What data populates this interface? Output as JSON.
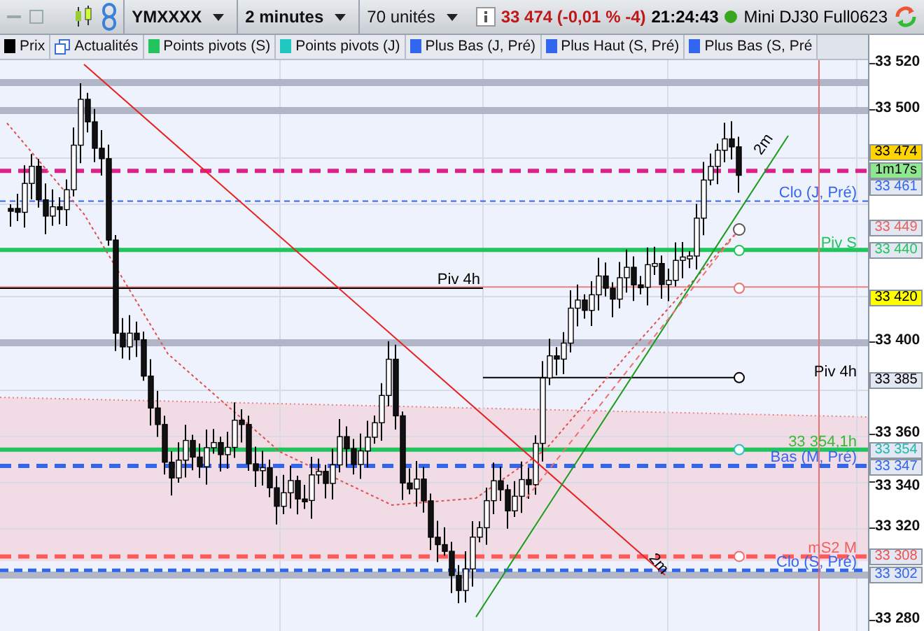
{
  "toolbar": {
    "symbol": "YMXXXX",
    "timeframe": "2 minutes",
    "units": "70 unités",
    "quote": "33 474 (-0,01 % -4)",
    "time": "21:24:43",
    "connected": true,
    "instrument": "Mini DJ30 Full0623"
  },
  "legend": [
    {
      "kind": "swatch",
      "label": "Prix",
      "color": "#000000"
    },
    {
      "kind": "icon",
      "label": "Actualités"
    },
    {
      "kind": "swatch",
      "label": "Points pivots (S)",
      "color": "#22c45e"
    },
    {
      "kind": "swatch",
      "label": "Points pivots (J)",
      "color": "#1fc7c0"
    },
    {
      "kind": "swatch",
      "label": "Plus Bas (J, Pré)",
      "color": "#3366ee"
    },
    {
      "kind": "swatch",
      "label": "Plus Haut (S, Pré)",
      "color": "#3366ee"
    },
    {
      "kind": "swatch",
      "label": "Plus Bas (S, Pré",
      "color": "#3366ee"
    }
  ],
  "annotations": [
    {
      "text": "Piv 4h",
      "color": "#000000"
    },
    {
      "text": "Clo (J, Pré)",
      "color": "#3366ee"
    },
    {
      "text": "Piv S",
      "color": "#22c45e"
    },
    {
      "text": "Piv 4h",
      "color": "#000000"
    },
    {
      "text": "33 354,1h",
      "color": "#33bb33"
    },
    {
      "text": "Bas (M, Pré)",
      "color": "#3366ee"
    },
    {
      "text": "mS2 M",
      "color": "#f06060"
    },
    {
      "text": "Clo (S, Pré)",
      "color": "#3366ee"
    },
    {
      "text": "2m",
      "color": "#000000"
    },
    {
      "text": "2m",
      "color": "#000000"
    }
  ],
  "price_axis": {
    "ticks": [
      "33 520",
      "33 500",
      "33 400",
      "33 360",
      "33 340",
      "33 320",
      "33 280"
    ],
    "markers": [
      {
        "text": "33 474",
        "kind": "filled",
        "color": "#ffd400"
      },
      {
        "text": "1m17s",
        "kind": "filled",
        "color": "#8fe88f"
      },
      {
        "text": "33 461",
        "kind": "outline",
        "color": "#3366ee"
      },
      {
        "text": "33 449",
        "kind": "outline",
        "color": "#e86060"
      },
      {
        "text": "33 440",
        "kind": "outline",
        "color": "#22c45e"
      },
      {
        "text": "33 420",
        "kind": "filled",
        "color": "#ffff00"
      },
      {
        "text": "33 385",
        "kind": "outline",
        "color": "#000000"
      },
      {
        "text": "33 354",
        "kind": "outline",
        "color": "#1fb8b0"
      },
      {
        "text": "33 347",
        "kind": "outline",
        "color": "#3366ee"
      },
      {
        "text": "33 308",
        "kind": "outline",
        "color": "#f05050"
      },
      {
        "text": "33 302",
        "kind": "outline",
        "color": "#3366ee"
      }
    ]
  }
}
